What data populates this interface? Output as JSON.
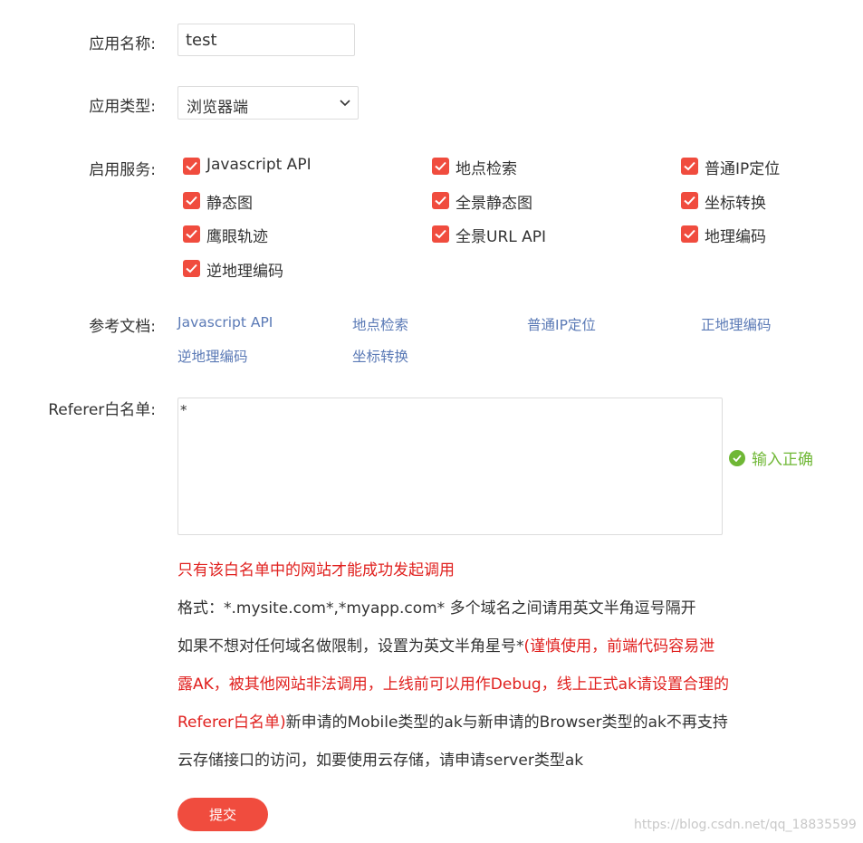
{
  "form": {
    "app_name": {
      "label": "应用名称:",
      "value": "test"
    },
    "app_type": {
      "label": "应用类型:",
      "selected": "浏览器端"
    },
    "services": {
      "label": "启用服务:",
      "items": [
        {
          "label": "Javascript API",
          "checked": true
        },
        {
          "label": "地点检索",
          "checked": true
        },
        {
          "label": "普通IP定位",
          "checked": true
        },
        {
          "label": "静态图",
          "checked": true
        },
        {
          "label": "全景静态图",
          "checked": true
        },
        {
          "label": "坐标转换",
          "checked": true
        },
        {
          "label": "鹰眼轨迹",
          "checked": true
        },
        {
          "label": "全景URL API",
          "checked": true
        },
        {
          "label": "地理编码",
          "checked": true
        },
        {
          "label": "逆地理编码",
          "checked": true
        }
      ]
    },
    "docs": {
      "label": "参考文档:",
      "links": [
        "Javascript API",
        "地点检索",
        "普通IP定位",
        "正地理编码",
        "逆地理编码",
        "坐标转换"
      ]
    },
    "referer": {
      "label": "Referer白名单:",
      "value": "*",
      "validation": "输入正确"
    },
    "notes": {
      "warning": "只有该白名单中的网站才能成功发起调用",
      "format": "格式：*.mysite.com*,*myapp.com* 多个域名之间请用英文半角逗号隔开",
      "line3_normal": "如果不想对任何域名做限制，设置为英文半角星号*",
      "line3_red": "(谨慎使用，前端代码容易泄",
      "line4_red": "露AK，被其他网站非法调用，上线前可以用作Debug，线上正式ak请设置合理的",
      "line5_red": "Referer白名单)",
      "line5_normal": "新申请的Mobile类型的ak与新申请的Browser类型的ak不再支持",
      "line6_normal": "云存储接口的访问，如要使用云存储，请申请server类型ak"
    },
    "submit_label": "提交"
  },
  "watermark": "https://blog.csdn.net/qq_18835599",
  "colors": {
    "accent": "#f04c3e",
    "link": "#5b7ab6",
    "success": "#6fb735",
    "warning": "#e0201e"
  }
}
